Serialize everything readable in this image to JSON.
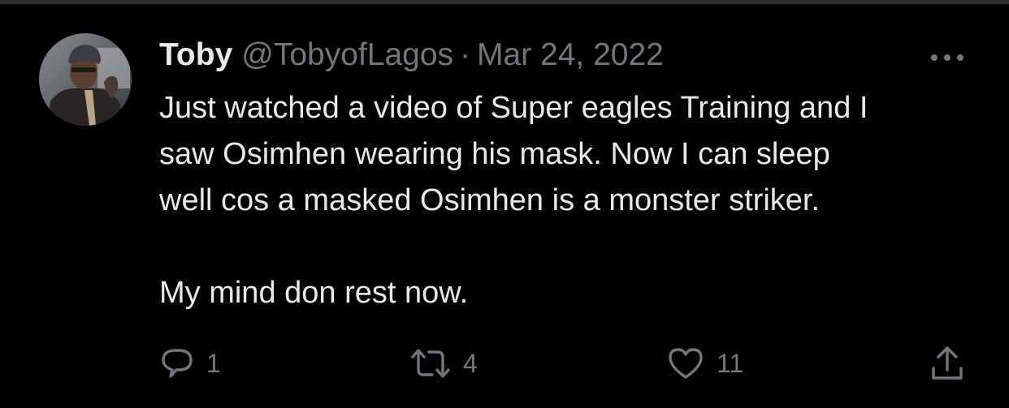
{
  "tweet": {
    "author": {
      "display_name": "Toby",
      "handle": "@TobyofLagos",
      "avatar_icon": "profile-photo"
    },
    "separator": "·",
    "date": "Mar 24, 2022",
    "more_icon": "more-horizontal-icon",
    "text_lines": [
      "Just watched a video of Super eagles Training and I",
      "saw Osimhen wearing his mask. Now I can sleep",
      "well cos a masked Osimhen is a monster striker.",
      "",
      "My mind don rest now."
    ],
    "actions": {
      "reply": {
        "icon": "reply-icon",
        "count": "1"
      },
      "retweet": {
        "icon": "retweet-icon",
        "count": "4"
      },
      "like": {
        "icon": "heart-icon",
        "count": "11"
      },
      "share": {
        "icon": "share-icon"
      }
    }
  },
  "colors": {
    "background": "#000000",
    "primary_text": "#e7e9ea",
    "secondary_text": "#71767b",
    "divider": "#2f3336"
  }
}
